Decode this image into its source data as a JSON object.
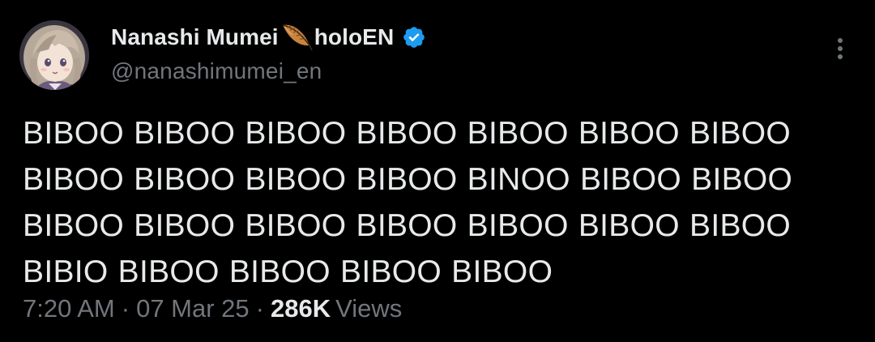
{
  "author": {
    "display_name_part1": "Nanashi Mumei",
    "display_name_part2": "holoEN",
    "handle": "@nanashimumei_en",
    "verified": true,
    "verified_color": "#1d9bf0",
    "emoji_icon": "feather-icon"
  },
  "tweet": {
    "lines": [
      "BIBOO BIBOO BIBOO BIBOO BIBOO BIBOO BIBOO",
      "BIBOO BIBOO BIBOO BIBOO BINOO BIBOO BIBOO",
      "BIBOO BIBOO BIBOO BIBOO BIBOO BIBOO BIBOO",
      "BIBIO BIBOO BIBOO BIBOO BIBOO"
    ]
  },
  "meta": {
    "time": "7:20 AM",
    "separator": "·",
    "date": "07 Mar 25",
    "views_count": "286K",
    "views_label": "Views"
  },
  "menu": {
    "icon": "more-options-icon"
  },
  "colors": {
    "background": "#000000",
    "primary_text": "#e7e9ea",
    "secondary_text": "#71767b"
  }
}
